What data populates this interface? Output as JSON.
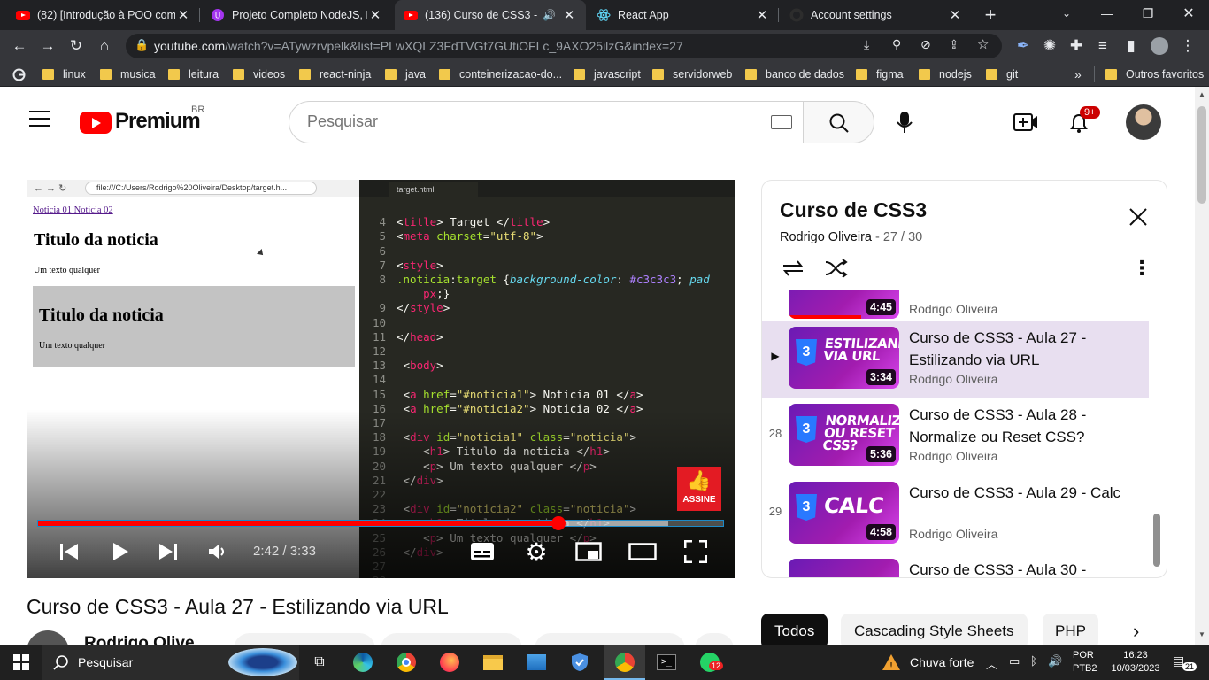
{
  "browser": {
    "tabs": [
      {
        "title": "(82) [Introdução à POO com",
        "icon": "youtube-icon"
      },
      {
        "title": "Projeto Completo NodeJS, R",
        "icon": "udemy-icon"
      },
      {
        "title": "(136) Curso de CSS3 - Au",
        "icon": "youtube-icon",
        "active": true
      },
      {
        "title": "React App",
        "icon": "react-icon"
      },
      {
        "title": "Account settings",
        "icon": "github-icon"
      }
    ],
    "url_host": "youtube.com",
    "url_path": "/watch?v=ATywzrvpelk&list=PLwXQLZ3FdTVGf7GUtiOFLc_9AXO25ilzG&index=27",
    "bookmarks": [
      "linux",
      "musica",
      "leitura",
      "videos",
      "react-ninja",
      "java",
      "conteinerizacao-do...",
      "javascript",
      "servidorweb",
      "banco de dados",
      "figma",
      "nodejs",
      "git"
    ],
    "bookmarks_overflow": "»",
    "other_bookmarks": "Outros favoritos"
  },
  "youtube": {
    "logo_text": "Premium",
    "region": "BR",
    "search_placeholder": "Pesquisar",
    "notif_count": "9+"
  },
  "video": {
    "time_current": "2:42",
    "time_total": "3:33",
    "progress_fraction": 0.76,
    "buffered_fraction": 0.92,
    "title": "Curso de CSS3 - Aula 27 - Estilizando via URL",
    "channel": "Rodrigo Olive",
    "subscribe_badge": "ASSINE",
    "screen": {
      "browser_url": "file:///C:/Users/Rodrigo%20Oliveira/Desktop/target.h...",
      "links": "Noticia 01 Noticia 02",
      "heading1": "Titulo da noticia",
      "text1": "Um texto qualquer",
      "heading2": "Titulo da noticia",
      "text2": "Um texto qualquer",
      "editor_tab": "target.html"
    }
  },
  "playlist": {
    "title": "Curso de CSS3",
    "channel": "Rodrigo Oliveira",
    "position": "27 / 30",
    "items": [
      {
        "index": "",
        "thumb_text": "",
        "duration": "4:45",
        "title": "",
        "channel": "Rodrigo Oliveira"
      },
      {
        "index": "▶",
        "thumb_text": "ESTILIZANDO VIA URL",
        "duration": "3:34",
        "title": "Curso de CSS3 - Aula 27 - Estilizando via URL",
        "channel": "Rodrigo Oliveira",
        "current": true
      },
      {
        "index": "28",
        "thumb_text": "NORMALIZE OU RESET CSS?",
        "duration": "5:36",
        "title": "Curso de CSS3 - Aula 28 - Normalize ou Reset CSS?",
        "channel": "Rodrigo Oliveira"
      },
      {
        "index": "29",
        "thumb_text": "CALC",
        "duration": "4:58",
        "title": "Curso de CSS3 - Aula 29 - Calc",
        "channel": "Rodrigo Oliveira"
      },
      {
        "index": "",
        "thumb_text": "",
        "duration": "",
        "title": "Curso de CSS3 - Aula 30 -",
        "channel": ""
      }
    ]
  },
  "chips": [
    "Todos",
    "Cascading Style Sheets",
    "PHP"
  ],
  "taskbar": {
    "search": "Pesquisar",
    "weather": "Chuva forte",
    "lang1": "POR",
    "lang2": "PTB2",
    "time": "16:23",
    "date": "10/03/2023",
    "whatsapp_badge": "12",
    "notif_count": "21"
  },
  "colors": {
    "yt_red": "#ff0000",
    "playlist_current_bg": "#e8dff0",
    "accent_purple": "#9333ea"
  }
}
